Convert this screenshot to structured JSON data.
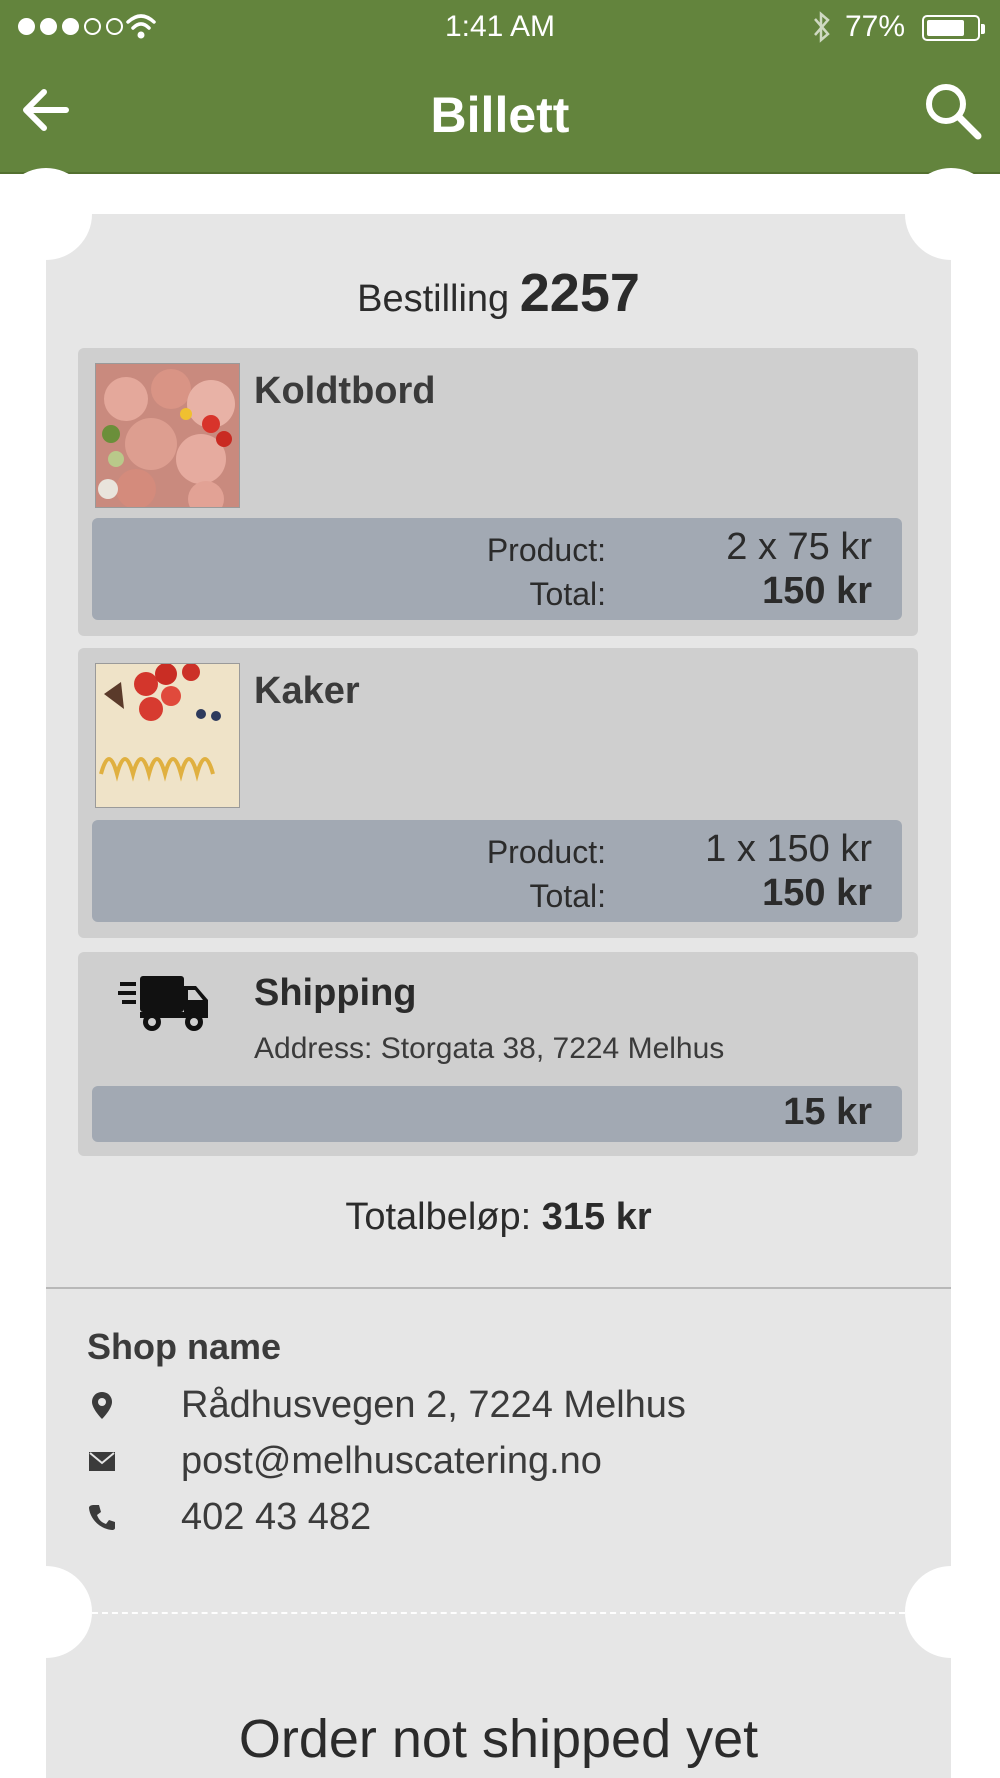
{
  "status_bar": {
    "time": "1:41 AM",
    "battery_pct": "77%",
    "battery_level": 0.77,
    "signal_bars_filled": 3,
    "signal_bars_total": 5
  },
  "nav": {
    "title": "Billett",
    "back_icon": "arrow-left-icon",
    "search_icon": "search-icon"
  },
  "order": {
    "label": "Bestilling",
    "number": "2257"
  },
  "items": [
    {
      "name": "Koldtbord",
      "product_label": "Product:",
      "product_value": "2 x 75 kr",
      "total_label": "Total:",
      "total_value": "150 kr"
    },
    {
      "name": "Kaker",
      "product_label": "Product:",
      "product_value": "1 x 150 kr",
      "total_label": "Total:",
      "total_value": "150 kr"
    }
  ],
  "shipping": {
    "name": "Shipping",
    "address": "Address: Storgata 38, 7224 Melhus",
    "price": "15 kr",
    "icon": "truck-icon"
  },
  "total": {
    "label": "Totalbeløp:",
    "value": "315 kr"
  },
  "shop": {
    "name": "Shop name",
    "address": "Rådhusvegen 2, 7224 Melhus",
    "email": "post@melhuscatering.no",
    "phone": "402 43 482"
  },
  "status_message": "Order not shipped yet",
  "colors": {
    "header_green": "#63843d",
    "ticket_bg": "#e6e6e6",
    "item_bg": "#cfcfcf",
    "price_bar": "#a2a9b3"
  }
}
